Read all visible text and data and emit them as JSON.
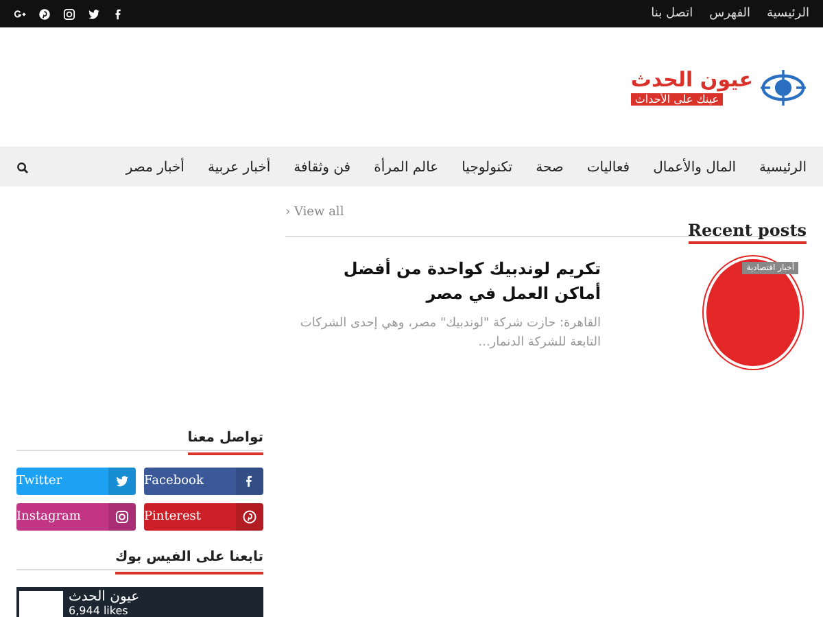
{
  "top_bar": {
    "links": [
      "الرئيسية",
      "الفهرس",
      "اتصل بنا"
    ],
    "social": [
      {
        "kind": "facebook"
      },
      {
        "kind": "twitter"
      },
      {
        "kind": "instagram"
      },
      {
        "kind": "pinterest"
      },
      {
        "kind": "googleplus"
      }
    ]
  },
  "logo": {
    "name": "عيون الحدث",
    "tagline": "عينك على الأحداث"
  },
  "nav": {
    "items": [
      "الرئيسية",
      "المال والأعمال",
      "فعاليات",
      "صحة",
      "تكنولوجيا",
      "عالم المرأة",
      "فن وثقافة",
      "أخبار عربية",
      "أخبار مصر"
    ]
  },
  "recent_posts": {
    "title": "Recent posts",
    "view_all": "› View all",
    "posts": [
      {
        "category": "أخبار اقتصادية",
        "title": "تكريم لوندبيك كواحدة من أفضل أماكن العمل في مصر",
        "excerpt": "القاهرة:  حازت شركة \"لوندبيك\" مصر، وهي إحدى الشركات التابعة للشركة الدنمار..."
      }
    ]
  },
  "contact_widget": {
    "title": "تواصل معنا",
    "buttons": [
      {
        "kind": "facebook",
        "label": "Facebook",
        "color": "#3b5998"
      },
      {
        "kind": "twitter",
        "label": "Twitter",
        "color": "#1da1f2"
      },
      {
        "kind": "pinterest",
        "label": "Pinterest",
        "color": "#cb2027"
      },
      {
        "kind": "instagram",
        "label": "Instagram",
        "color": "#c13584"
      }
    ]
  },
  "facebook_widget": {
    "title": "تابعنا على الفيس بوك",
    "page_name": "عيون الحدث",
    "likes": "6,944 likes"
  }
}
